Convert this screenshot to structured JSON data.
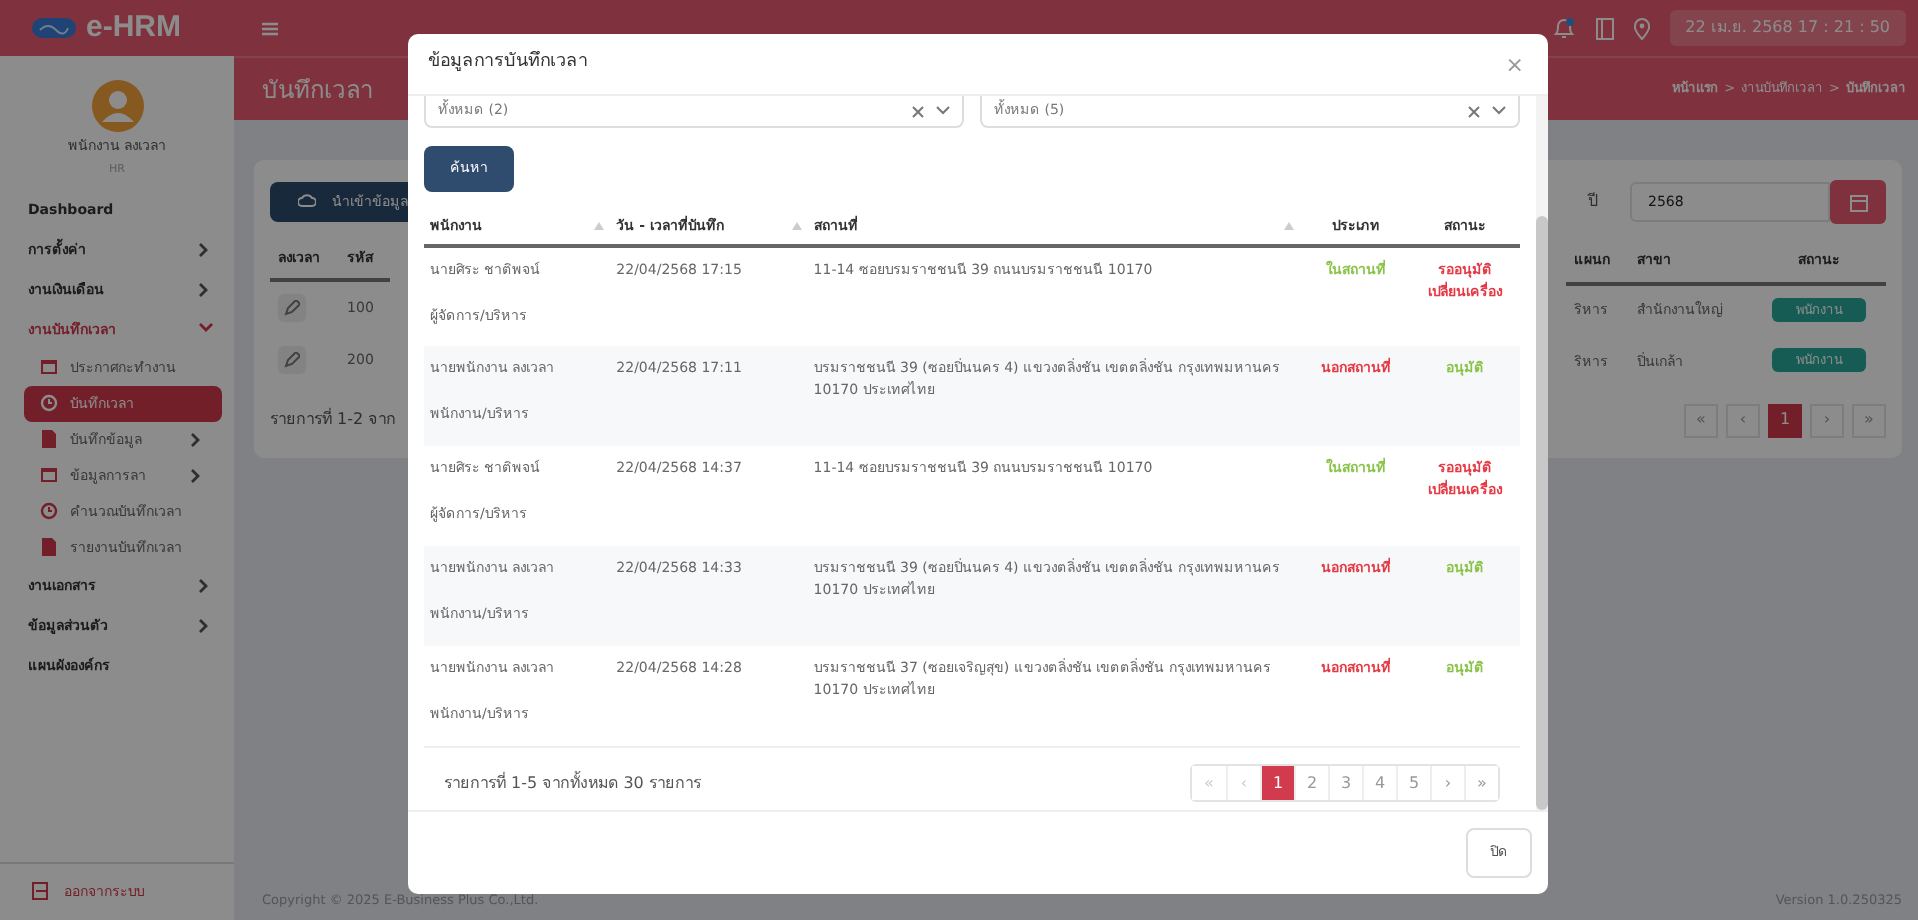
{
  "app": {
    "brand": "e-HRM",
    "datetime": "22 เม.ย. 2568  17 : 21 : 50",
    "notification_dot": true
  },
  "sidebar": {
    "user_name": "พนักงาน ลงเวลา",
    "user_role": "HR",
    "items": [
      {
        "label": "Dashboard"
      },
      {
        "label": "การตั้งค่า",
        "expanded": false
      },
      {
        "label": "งานเงินเดือน",
        "expanded": false
      },
      {
        "label": "งานบันทึกเวลา",
        "expanded": true,
        "children": [
          {
            "label": "ประกาศกะทำงาน",
            "selected": false
          },
          {
            "label": "บันทึกเวลา",
            "selected": true
          },
          {
            "label": "บันทึกข้อมูล",
            "selected": false,
            "expanded": false
          },
          {
            "label": "ข้อมูลการลา",
            "selected": false,
            "expanded": false
          },
          {
            "label": "คำนวณบันทึกเวลา",
            "selected": false
          },
          {
            "label": "รายงานบันทึกเวลา",
            "selected": false
          }
        ]
      },
      {
        "label": "งานเอกสาร",
        "expanded": false
      },
      {
        "label": "ข้อมูลส่วนตัว",
        "expanded": false
      },
      {
        "label": "แผนผังองค์กร"
      }
    ],
    "logout": "ออกจากระบบ"
  },
  "page": {
    "title": "บันทึกเวลา",
    "breadcrumb": [
      "หน้าแรก",
      "งานบันทึกเวลา",
      "บันทึกเวลา"
    ],
    "breadcrumb_separator": ">",
    "import_button": "นำเข้าข้อมูล",
    "year_label": "ปี",
    "year_value": "2568",
    "left_columns": [
      "ลงเวลา",
      "รหัส"
    ],
    "right_columns": [
      "แผนก",
      "สาขา",
      "สถานะ"
    ],
    "rows": [
      {
        "code": "100",
        "department": "ริหาร",
        "branch": "สำนักงานใหญ่",
        "status": "พนักงาน"
      },
      {
        "code": "200",
        "department": "ริหาร",
        "branch": "ปิ่นเกล้า",
        "status": "พนักงาน"
      }
    ],
    "summary": "รายการที่ 1-2 จาก",
    "pagination": [
      {
        "label": "«",
        "selected": false
      },
      {
        "label": "‹",
        "selected": false
      },
      {
        "label": "1",
        "selected": true
      },
      {
        "label": "›",
        "selected": false
      },
      {
        "label": "»",
        "selected": false
      }
    ],
    "copyright": "Copyright © 2025 E-Business Plus Co.,Ltd.",
    "version": "Version 1.0.250325"
  },
  "modal": {
    "title": "ข้อมูลการบันทึกเวลา",
    "close": "×",
    "filters": [
      {
        "value": "ทั้งหมด (2)"
      },
      {
        "value": "ทั้งหมด (5)"
      }
    ],
    "search_button": "ค้นหา",
    "columns": [
      {
        "label": "พนักงาน",
        "sortable": true
      },
      {
        "label": "วัน - เวลาที่บันทึก",
        "sortable": true
      },
      {
        "label": "สถานที่",
        "sortable": true
      },
      {
        "label": "ประเภท",
        "sortable": false
      },
      {
        "label": "สถานะ",
        "sortable": false
      }
    ],
    "rows": [
      {
        "name": "นายศิระ ชาติพจน์",
        "position": "ผู้จัดการ/บริหาร",
        "datetime": "22/04/2568 17:15",
        "location": "11-14 ซอยบรมราชชนนี 39 ถนนบรมราชชนนี 10170",
        "type": {
          "text": "ในสถานที่",
          "color": "#8bc34a"
        },
        "status": {
          "text": "รออนุมัติเปลี่ยนเครื่อง",
          "color": "#e53945"
        }
      },
      {
        "name": "นายพนักงาน ลงเวลา",
        "position": "พนักงาน/บริหาร",
        "datetime": "22/04/2568 17:11",
        "location": "บรมราชชนนี 39 (ซอยปิ่นนคร 4) แขวงตลิ่งชัน เขตตลิ่งชัน กรุงเทพมหานคร 10170 ประเทศไทย",
        "type": {
          "text": "นอกสถานที่",
          "color": "#e53945"
        },
        "status": {
          "text": "อนุมัติ",
          "color": "#8bc34a"
        }
      },
      {
        "name": "นายศิระ ชาติพจน์",
        "position": "ผู้จัดการ/บริหาร",
        "datetime": "22/04/2568 14:37",
        "location": "11-14 ซอยบรมราชชนนี 39 ถนนบรมราชชนนี 10170",
        "type": {
          "text": "ในสถานที่",
          "color": "#8bc34a"
        },
        "status": {
          "text": "รออนุมัติเปลี่ยนเครื่อง",
          "color": "#e53945"
        }
      },
      {
        "name": "นายพนักงาน ลงเวลา",
        "position": "พนักงาน/บริหาร",
        "datetime": "22/04/2568 14:33",
        "location": "บรมราชชนนี 39 (ซอยปิ่นนคร 4) แขวงตลิ่งชัน เขตตลิ่งชัน กรุงเทพมหานคร 10170 ประเทศไทย",
        "type": {
          "text": "นอกสถานที่",
          "color": "#e53945"
        },
        "status": {
          "text": "อนุมัติ",
          "color": "#8bc34a"
        }
      },
      {
        "name": "นายพนักงาน ลงเวลา",
        "position": "พนักงาน/บริหาร",
        "datetime": "22/04/2568 14:28",
        "location": "บรมราชชนนี 37 (ซอยเจริญสุข) แขวงตลิ่งชัน เขตตลิ่งชัน กรุงเทพมหานคร 10170 ประเทศไทย",
        "type": {
          "text": "นอกสถานที่",
          "color": "#e53945"
        },
        "status": {
          "text": "อนุมัติ",
          "color": "#8bc34a"
        }
      }
    ],
    "summary": "รายการที่ 1-5 จากทั้งหมด 30 รายการ",
    "pagination": [
      {
        "label": "«",
        "selected": false,
        "disabled": true
      },
      {
        "label": "‹",
        "selected": false,
        "disabled": true
      },
      {
        "label": "1",
        "selected": true,
        "disabled": false
      },
      {
        "label": "2",
        "selected": false,
        "disabled": false
      },
      {
        "label": "3",
        "selected": false,
        "disabled": false
      },
      {
        "label": "4",
        "selected": false,
        "disabled": false
      },
      {
        "label": "5",
        "selected": false,
        "disabled": false
      },
      {
        "label": "›",
        "selected": false,
        "disabled": false
      },
      {
        "label": "»",
        "selected": false,
        "disabled": false
      }
    ],
    "close_button": "ปิด"
  }
}
